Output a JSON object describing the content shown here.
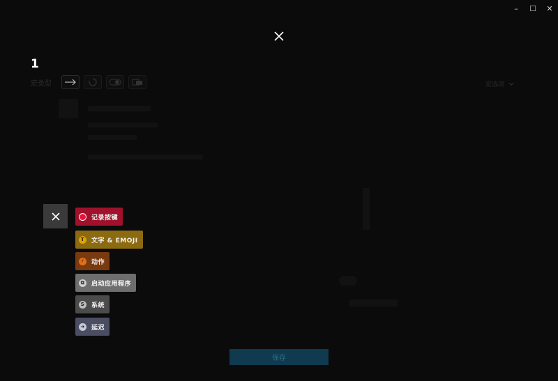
{
  "window": {
    "minimize_label": "–",
    "maximize_label": "☐",
    "close_label": "✕"
  },
  "macro": {
    "title": "1",
    "type_label": "宏类型",
    "options_label": "宏选项"
  },
  "menu": {
    "items": [
      {
        "label": "记录按键",
        "color": "#a0112b",
        "icon_color": "#e8143c",
        "icon_glyph": ""
      },
      {
        "label": "文字 & EMOJI",
        "color": "#8c6a10",
        "icon_color": "#e0a400",
        "icon_glyph": "T"
      },
      {
        "label": "动作",
        "color": "#7a3a10",
        "icon_color": "#e0701a",
        "icon_glyph": "⚡"
      },
      {
        "label": "启动应用程序",
        "color": "#6e6e6e",
        "icon_color": "#cfcfcf",
        "icon_glyph": "⧉"
      },
      {
        "label": "系统",
        "color": "#4b4b4b",
        "icon_color": "#bdbdbd",
        "icon_glyph": "S"
      },
      {
        "label": "延迟",
        "color": "#4b4e63",
        "icon_color": "#c7c9d8",
        "icon_glyph": "➜"
      }
    ]
  },
  "save_label": "保存"
}
